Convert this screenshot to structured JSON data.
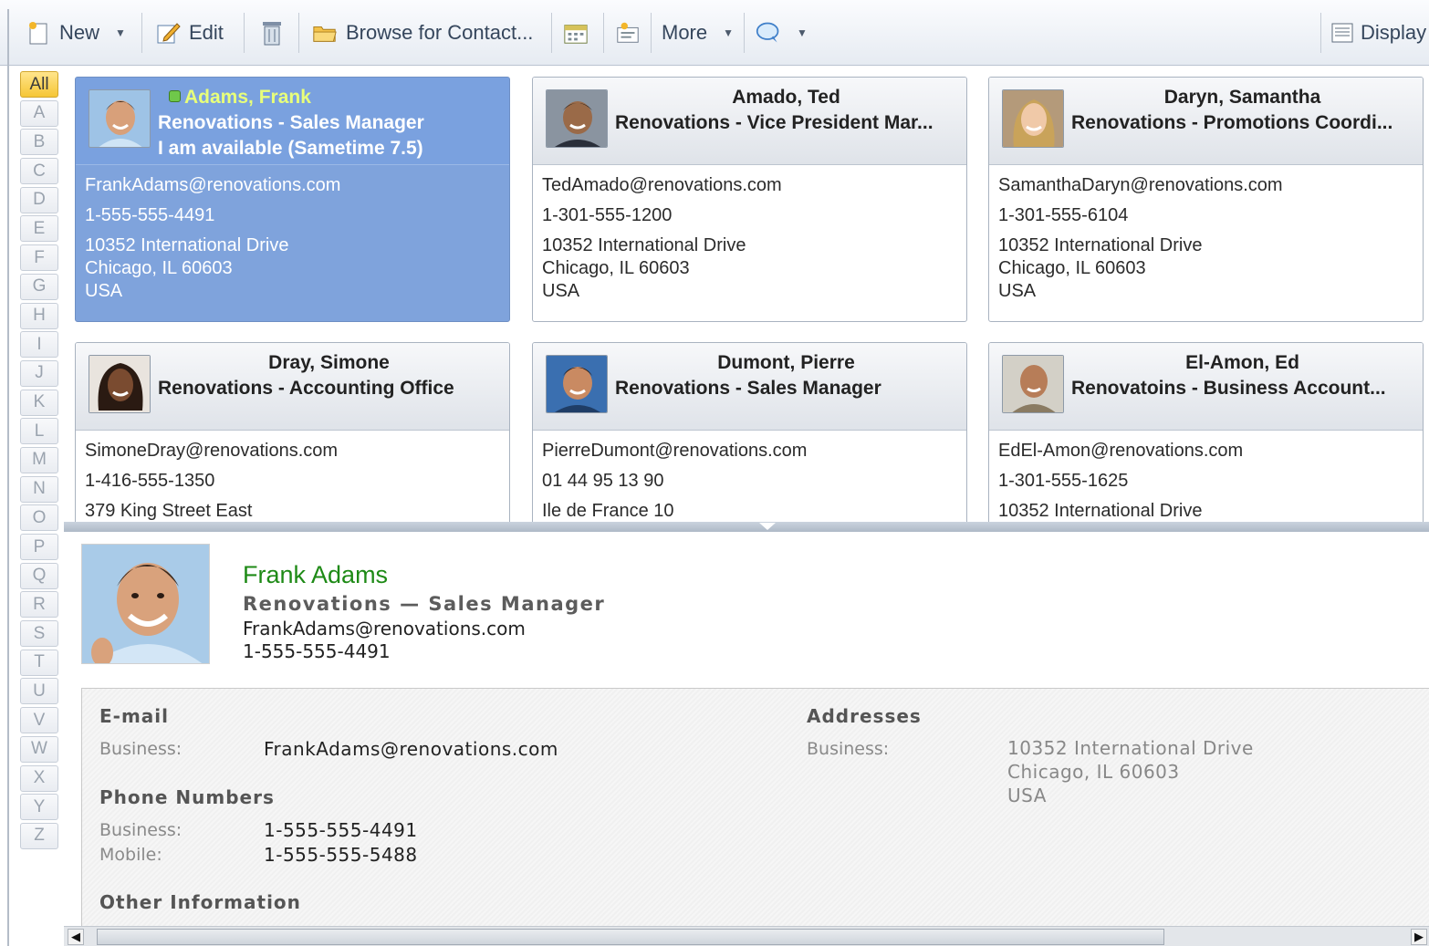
{
  "toolbar": {
    "new_label": "New",
    "edit_label": "Edit",
    "browse_label": "Browse for Contact...",
    "more_label": "More",
    "display_label": "Display"
  },
  "alphabet": [
    "All",
    "A",
    "B",
    "C",
    "D",
    "E",
    "F",
    "G",
    "H",
    "I",
    "J",
    "K",
    "L",
    "M",
    "N",
    "O",
    "P",
    "Q",
    "R",
    "S",
    "T",
    "U",
    "V",
    "W",
    "X",
    "Y",
    "Z"
  ],
  "cards": [
    {
      "name": "Adams, Frank",
      "org": "Renovations - Sales Manager",
      "status": "I am available  (Sametime 7.5)",
      "email": "FrankAdams@renovations.com",
      "phone": "1-555-555-4491",
      "addr1": "10352 International Drive",
      "addr2": "Chicago, IL 60603",
      "addr3": "USA",
      "selected": true
    },
    {
      "name": "Amado, Ted",
      "org": "Renovations - Vice President Mar...",
      "email": "TedAmado@renovations.com",
      "phone": "1-301-555-1200",
      "addr1": "10352 International Drive",
      "addr2": "Chicago, IL 60603",
      "addr3": "USA"
    },
    {
      "name": "Daryn, Samantha",
      "org": "Renovations - Promotions Coordi...",
      "email": "SamanthaDaryn@renovations.com",
      "phone": "1-301-555-6104",
      "addr1": "10352 International Drive",
      "addr2": "Chicago, IL 60603",
      "addr3": "USA"
    },
    {
      "name": "Dray, Simone",
      "org": "Renovations - Accounting Office",
      "email": "SimoneDray@renovations.com",
      "phone": "1-416-555-1350",
      "addr1": "379 King Street East"
    },
    {
      "name": "Dumont, Pierre",
      "org": "Renovations - Sales Manager",
      "email": "PierreDumont@renovations.com",
      "phone": "01 44 95 13 90",
      "addr1": "Ile de France 10"
    },
    {
      "name": "El-Amon, Ed",
      "org": "Renovatoins - Business Account...",
      "email": "EdEl-Amon@renovations.com",
      "phone": "1-301-555-1625",
      "addr1": "10352 International Drive"
    }
  ],
  "detail": {
    "name": "Frank Adams",
    "org": "Renovations  —  Sales Manager",
    "email": "FrankAdams@renovations.com",
    "phone": "1-555-555-4491",
    "sections": {
      "email_title": "E-mail",
      "email_label": "Business:",
      "email_value": "FrankAdams@renovations.com",
      "phones_title": "Phone Numbers",
      "phone_business_label": "Business:",
      "phone_business_value": "1-555-555-4491",
      "phone_mobile_label": "Mobile:",
      "phone_mobile_value": "1-555-555-5488",
      "other_title": "Other Information",
      "addresses_title": "Addresses",
      "address_label": "Business:",
      "address_line1": "10352 International Drive",
      "address_line2": "Chicago, IL  60603",
      "address_line3": "USA"
    }
  },
  "colors": {
    "selected_card": "#7aa1df",
    "name_green": "#1e8a16",
    "active_letter": "#f6c635"
  }
}
